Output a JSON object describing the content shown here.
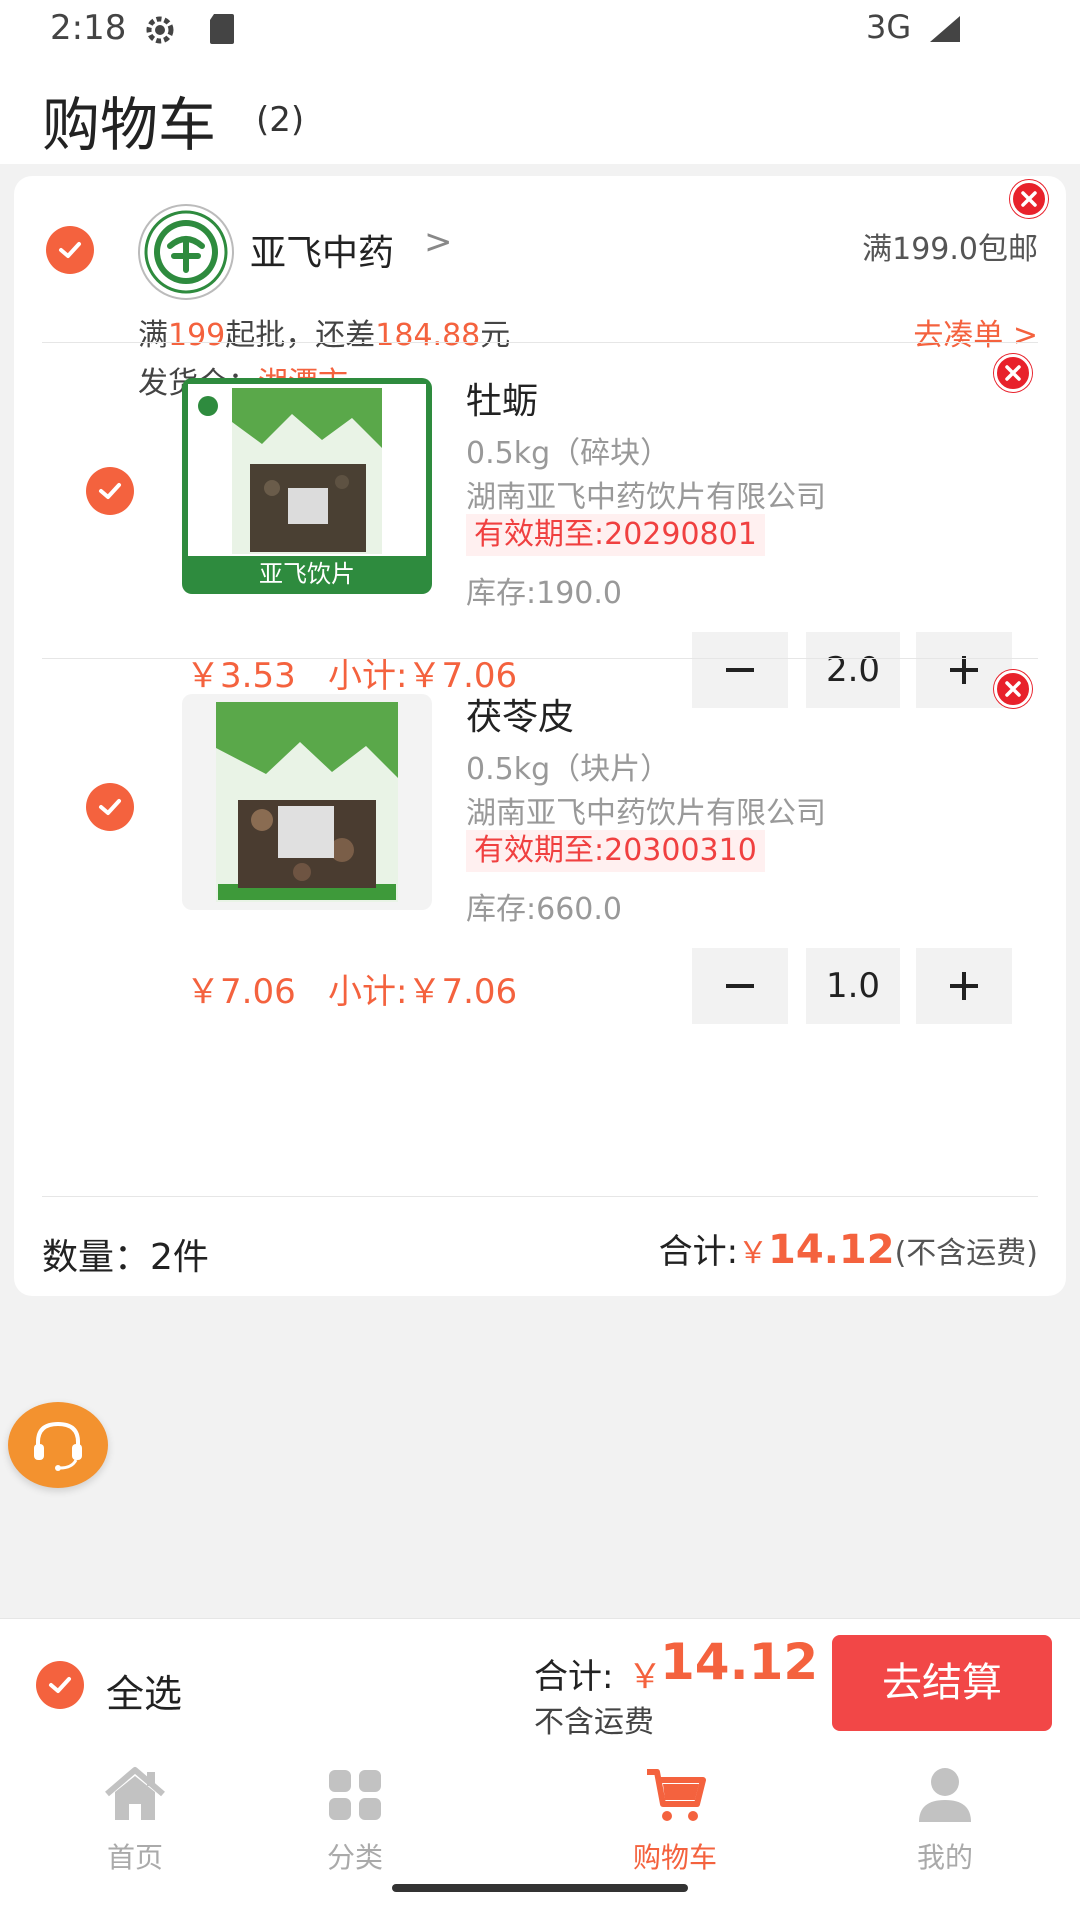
{
  "status": {
    "time": "2:18",
    "network": "3G"
  },
  "header": {
    "title": "购物车",
    "count": "(2)"
  },
  "store": {
    "name": "亚飞中药",
    "chevron": ">",
    "free_shipping": "满199.0包邮",
    "min_prefix": "满",
    "min_amount": "199",
    "min_mid": "起批，还差",
    "min_gap": "184.88",
    "min_suffix": "元",
    "go_collect": "去凑单 >",
    "warehouse_label": "发货仓：",
    "warehouse_city": "湘潭市"
  },
  "items": [
    {
      "name": "牡蛎",
      "spec": "0.5kg（碎块）",
      "maker": "湖南亚飞中药饮片有限公司",
      "expiry": "有效期至:20290801",
      "stock": "库存:190.0",
      "price": "￥3.53",
      "subtotal": "小计:￥7.06",
      "qty": "2.0",
      "label_band": "亚飞饮片"
    },
    {
      "name": "茯苓皮",
      "spec": "0.5kg（块片）",
      "maker": "湖南亚飞中药饮片有限公司",
      "expiry": "有效期至:20300310",
      "stock": "库存:660.0",
      "price": "￥7.06",
      "subtotal": "小计:￥7.06",
      "qty": "1.0"
    }
  ],
  "summary": {
    "qty_text": "数量：2件",
    "total_label": "合计:",
    "yen": "￥",
    "total_amount": "14.12",
    "shipping_note": "(不含运费)"
  },
  "checkout_bar": {
    "select_all": "全选",
    "total_label": "合计:",
    "yen": "￥",
    "total_amount": "14.12",
    "shipping_note": "不含运费",
    "checkout_button": "去结算"
  },
  "tabbar": {
    "items": [
      {
        "label": "首页",
        "icon": "home-icon"
      },
      {
        "label": "分类",
        "icon": "category-icon"
      },
      {
        "label": "购物车",
        "icon": "cart-icon"
      },
      {
        "label": "我的",
        "icon": "user-icon"
      }
    ],
    "active_index": 2
  },
  "colors": {
    "accent": "#f4623e",
    "checkout": "#f24747",
    "delete": "#e8212b",
    "service": "#f3922f"
  }
}
